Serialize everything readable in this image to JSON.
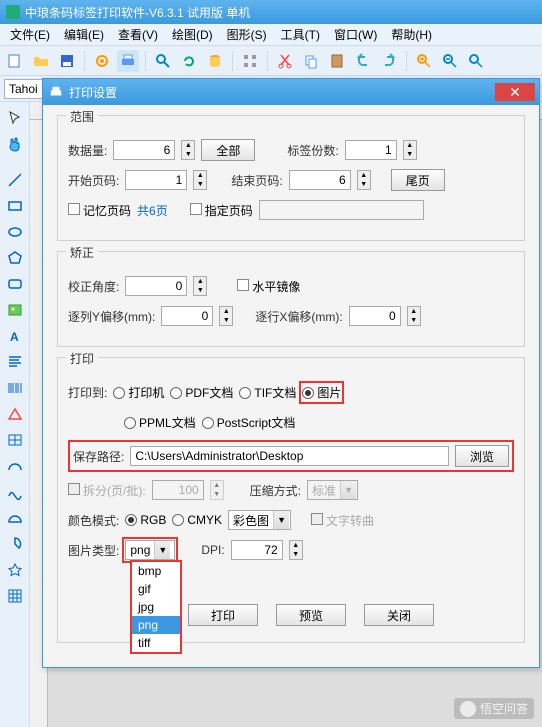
{
  "window": {
    "title": "中琅条码标签打印软件-V6.3.1 试用版 单机"
  },
  "menu": {
    "file": "文件(E)",
    "edit": "编辑(E)",
    "view": "查看(V)",
    "draw": "绘图(D)",
    "shape": "图形(S)",
    "tool": "工具(T)",
    "window": "窗口(W)",
    "help": "帮助(H)"
  },
  "font": {
    "family": "Tahoi"
  },
  "dialog": {
    "title": "打印设置",
    "range": {
      "legend": "范围",
      "data_qty_label": "数据量:",
      "data_qty": "6",
      "all_btn": "全部",
      "copies_label": "标签份数:",
      "copies": "1",
      "start_label": "开始页码:",
      "start": "1",
      "end_label": "结束页码:",
      "end": "6",
      "last_btn": "尾页",
      "remember": "记忆页码",
      "total_pages": "共6页",
      "specify": "指定页码"
    },
    "adjust": {
      "legend": "矫正",
      "angle_label": "校正角度:",
      "angle": "0",
      "mirror": "水平镜像",
      "col_offset_label": "逐列Y偏移(mm):",
      "col_offset": "0",
      "row_offset_label": "逐行X偏移(mm):",
      "row_offset": "0"
    },
    "print": {
      "legend": "打印",
      "dest_label": "打印到:",
      "opt_printer": "打印机",
      "opt_pdf": "PDF文档",
      "opt_tif": "TIF文档",
      "opt_img": "图片",
      "opt_ppml": "PPML文档",
      "opt_ps": "PostScript文档",
      "path_label": "保存路径:",
      "path": "C:\\Users\\Administrator\\Desktop",
      "browse": "浏览",
      "split": "拆分(页/批):",
      "split_val": "100",
      "compress_label": "压缩方式:",
      "compress_val": "标准",
      "color_label": "颜色模式:",
      "rgb": "RGB",
      "cmyk": "CMYK",
      "color_mode": "彩色图",
      "text_rotate": "文字转曲",
      "type_label": "图片类型:",
      "type_val": "png",
      "dpi_label": "DPI:",
      "dpi": "72",
      "dropdown": [
        "bmp",
        "gif",
        "jpg",
        "png",
        "tiff"
      ]
    },
    "buttons": {
      "print": "打印",
      "preview": "预览",
      "close": "关闭"
    }
  },
  "watermark": "悟空问答"
}
